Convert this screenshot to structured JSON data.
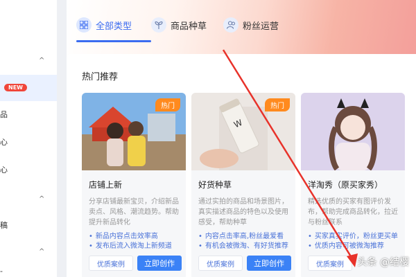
{
  "sidebar": {
    "badge_new": "NEW",
    "items": [
      {
        "label": "品"
      },
      {
        "label": "心"
      },
      {
        "label": "心"
      },
      {
        "label": "稿"
      },
      {
        "label": "-"
      }
    ],
    "chevron": "^"
  },
  "tabs": [
    {
      "label": "全部类型",
      "icon": "grid-icon",
      "active": true
    },
    {
      "label": "商品种草",
      "icon": "sprout-icon",
      "active": false
    },
    {
      "label": "粉丝运营",
      "icon": "users-icon",
      "active": false
    }
  ],
  "section": {
    "title": "热门推荐"
  },
  "cards": [
    {
      "badge": "热门",
      "title": "店铺上新",
      "desc": "分享店铺最新宝贝，介绍新品卖点、风格、潮流趋势。帮助提升新品转化",
      "bullets": [
        "新品内容点击效率高",
        "发布后流入微淘上新频道"
      ],
      "case_label": "优质案例",
      "create_label": "立即创作"
    },
    {
      "badge": "热门",
      "title": "好货种草",
      "desc": "通过实拍的商品和场景图片，真实描述商品的特色以及使用感受，帮助种草",
      "bullets": [
        "内容点击率高,粉丝最爱看",
        "有机会被微淘、有好货推荐"
      ],
      "case_label": "优质案例",
      "create_label": "立即创作"
    },
    {
      "badge": "",
      "title": "洋淘秀（原买家秀）",
      "desc": "精选优质的买家有图评价发布，帮助完成商品转化，拉近与粉丝联系",
      "bullets": [
        "买家真实评价，粉丝更买单",
        "优质内容可被微淘推荐"
      ],
      "case_label": "优质案例",
      "create_label": ""
    }
  ],
  "watermark": "头条 @结樱",
  "colors": {
    "accent": "#3b6cf0",
    "hot": "#ff8a1e",
    "arrow": "#e8322a"
  }
}
